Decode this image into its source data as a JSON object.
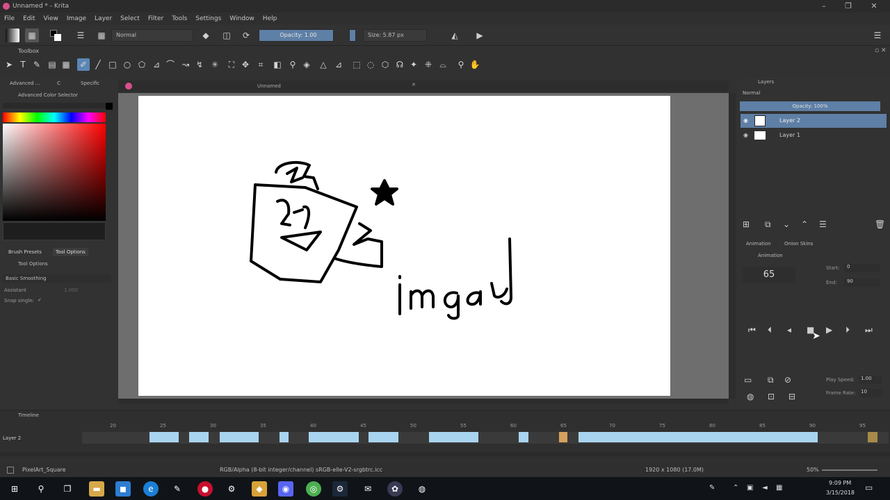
{
  "window": {
    "title": "Unnamed * - Krita",
    "min_icon": "minimize-icon",
    "max_icon": "maximize-icon",
    "close_icon": "close-icon"
  },
  "menu": [
    "File",
    "Edit",
    "View",
    "Image",
    "Layer",
    "Select",
    "Filter",
    "Tools",
    "Settings",
    "Window",
    "Help"
  ],
  "toolbar": {
    "blend_mode": "Normal",
    "opacity_label": "Opacity: 1.00",
    "size_label": "Size: 5.87 px"
  },
  "toolbox": {
    "title": "Toolbox"
  },
  "left_panel": {
    "tab_advanced": "Advanced ...",
    "tab_c": "C",
    "tab_specific": "Specific",
    "color_selector_title": "Advanced Color Selector",
    "brush_presets_tab": "Brush Presets",
    "tool_options_tab": "Tool Options",
    "tool_options_title": "Tool Options",
    "smoothing": "Basic Smoothing",
    "assistant_label": "Assistant",
    "assistant_value": "1.000",
    "snap_label": "Snap single:",
    "snap_check": "✓"
  },
  "document": {
    "tab_name": "Unnamed",
    "drawing_text": "imgay"
  },
  "layers": {
    "title": "Layers",
    "blend": "Normal",
    "opacity": "Opacity: 100%",
    "items": [
      {
        "name": "Layer 2",
        "selected": true
      },
      {
        "name": "Layer 1",
        "selected": false
      }
    ]
  },
  "animation": {
    "tab_animation": "Animation",
    "tab_onion": "Onion Skins",
    "title": "Animation",
    "current_frame": "65",
    "start_label": "Start:",
    "start_value": "0",
    "end_label": "End:",
    "end_value": "90",
    "play_speed_label": "Play Speed:",
    "play_speed_value": "1.00",
    "frame_rate_label": "Frame Rate:",
    "frame_rate_value": "10"
  },
  "timeline": {
    "title": "Timeline",
    "layer_label": "Layer 2",
    "ticks": [
      "20",
      "25",
      "30",
      "35",
      "40",
      "45",
      "50",
      "55",
      "60",
      "65",
      "70",
      "75",
      "80",
      "85",
      "90",
      "95"
    ]
  },
  "status": {
    "brush": "PixelArt_Square",
    "color_model": "RGB/Alpha (8-bit integer/channel)  sRGB-elle-V2-srgbtrc.icc",
    "dimensions": "1920 x 1080 (17.0M)",
    "zoom": "50%"
  },
  "taskbar": {
    "time": "9:09 PM",
    "date": "3/15/2018"
  },
  "colors": {
    "accent": "#5b86b5",
    "keyframe": "#a9d4ef"
  }
}
